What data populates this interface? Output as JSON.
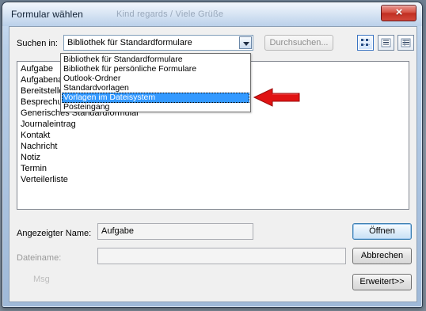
{
  "window": {
    "title": "Formular wählen",
    "background_title": "Kind regards / Viele Grüße"
  },
  "search": {
    "label": "Suchen in:",
    "selected_library": "Bibliothek für Standardformulare",
    "browse_label": "Durchsuchen..."
  },
  "view_buttons": [
    {
      "name": "icons-view",
      "icon": "large-icons-view-icon"
    },
    {
      "name": "list-view",
      "icon": "list-view-icon"
    },
    {
      "name": "details-view",
      "icon": "details-view-icon"
    }
  ],
  "dropdown": {
    "options": [
      {
        "label": "Bibliothek für Standardformulare"
      },
      {
        "label": "Bibliothek für persönliche Formulare"
      },
      {
        "label": "Outlook-Ordner"
      },
      {
        "label": "Standardvorlagen"
      },
      {
        "label": "Vorlagen im Dateisystem",
        "selected": true
      },
      {
        "label": "Posteingang"
      }
    ]
  },
  "forms": {
    "items": [
      "Aufgabe",
      "Aufgabenanfrage",
      "Bereitstellen in Ordner",
      "Besprechungsanfrage",
      "Generisches Standardformular",
      "Journaleintrag",
      "Kontakt",
      "Nachricht",
      "Notiz",
      "Termin",
      "Verteilerliste"
    ]
  },
  "details": {
    "displayed_name_label": "Angezeigter Name:",
    "displayed_name_value": "Aufgabe",
    "file_name_label": "Dateiname:",
    "file_name_value": "",
    "ghost_text": "Msg"
  },
  "buttons": {
    "open": "Öffnen",
    "cancel": "Abbrechen",
    "advanced": "Erweitert>>"
  },
  "colors": {
    "selection": "#3399ff",
    "annotation_arrow": "#e01313",
    "close_button": "#c12f22"
  }
}
